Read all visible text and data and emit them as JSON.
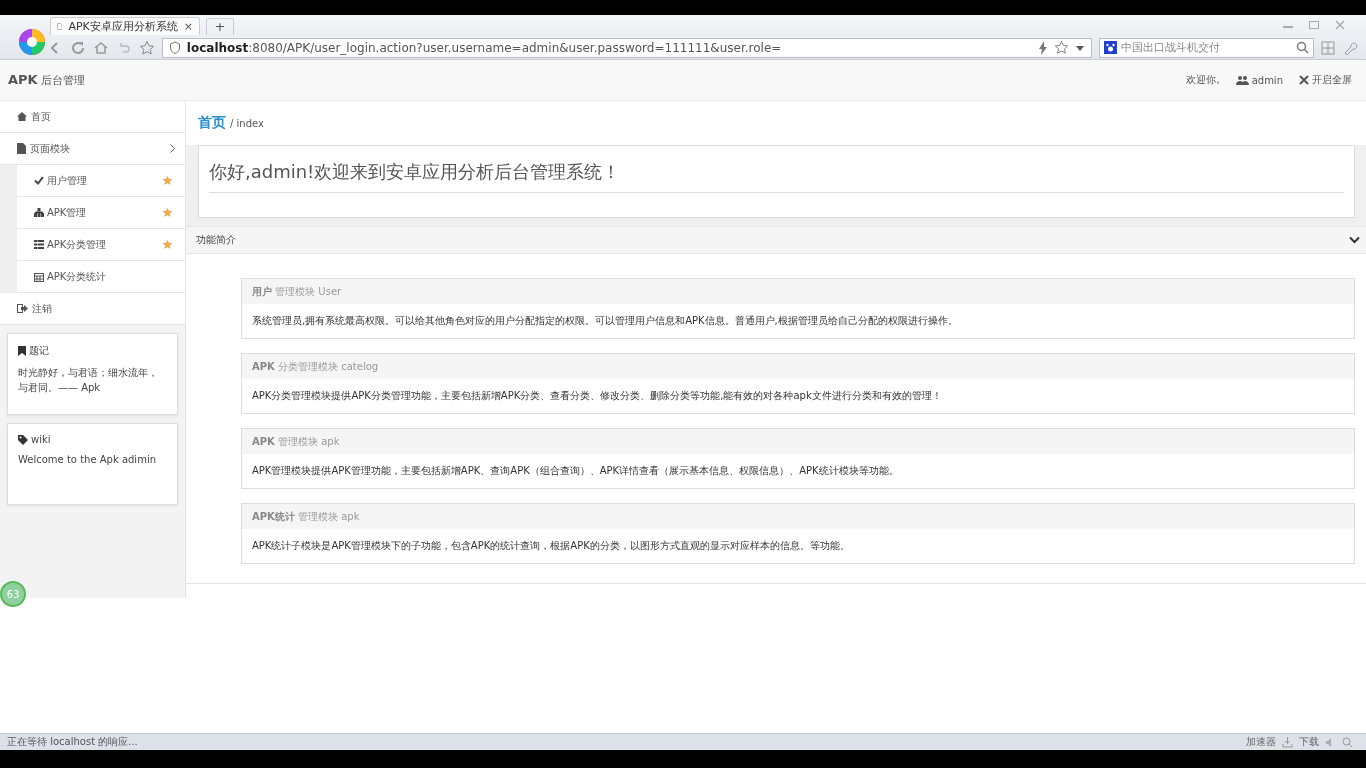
{
  "browser": {
    "tab_title": "APK安卓应用分析系统",
    "tab_close": "×",
    "new_tab": "+",
    "url_host": "localhost",
    "url_rest": ":8080/APK/user_login.action?user.username=admin&user.password=111111&user.role=",
    "search_placeholder": "中国出口战斗机交付"
  },
  "header": {
    "brand": "APK",
    "brand_sub": "后台管理",
    "welcome": "欢迎你,",
    "user": "admin",
    "fullscreen": "开启全屏"
  },
  "sidebar": {
    "items": [
      {
        "label": "首页"
      },
      {
        "label": "页面模块",
        "expanded": true,
        "children": [
          {
            "label": "用户管理",
            "starred": true
          },
          {
            "label": "APK管理",
            "starred": true
          },
          {
            "label": "APK分类管理",
            "starred": true
          },
          {
            "label": "APK分类统计",
            "starred": false
          }
        ]
      },
      {
        "label": "注销"
      }
    ]
  },
  "cards": [
    {
      "title": "题记",
      "text": "时光静好，与君语；细水流年，与君同。—— Apk"
    },
    {
      "title": "wiki",
      "text": "Welcome to the Apk adimin"
    }
  ],
  "badge": "63",
  "breadcrumb": {
    "current": "首页",
    "rest": "/ index"
  },
  "greeting": "你好,admin!欢迎来到安卓应用分析后台管理系统！",
  "panel": {
    "title": "功能简介",
    "expanded": true
  },
  "modules": [
    {
      "title": "**用户** 管理模块 User",
      "body": "系统管理员,拥有系统最高权限。可以给其他角色对应的用户分配指定的权限。可以管理用户信息和APK信息。普通用户,根据管理员给自己分配的权限进行操作。"
    },
    {
      "title": "**APK** 分类管理模块 catelog",
      "body": "APK分类管理模块提供APK分类管理功能，主要包括新增APK分类、查看分类、修改分类、删除分类等功能,能有效的对各种apk文件进行分类和有效的管理！"
    },
    {
      "title": "**APK** 管理模块 apk",
      "body": "APK管理模块提供APK管理功能，主要包括新增APK、查询APK（组合查询）、APK详情查看（展示基本信息、权限信息）、APK统计模块等功能。"
    },
    {
      "title": "**APK统计** 管理模块 apk",
      "body": "APK统计子模块是APK管理模块下的子功能，包含APK的统计查询，根据APK的分类，以图形方式直观的显示对应样本的信息。等功能。"
    }
  ],
  "status": {
    "text": "正在等待 localhost 的响应...",
    "accelerator": "加速器",
    "download": "下载"
  }
}
